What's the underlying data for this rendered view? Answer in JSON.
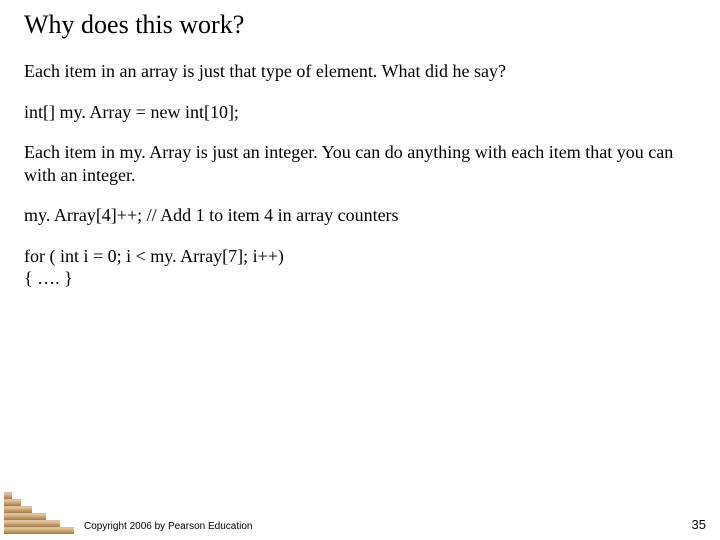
{
  "slide": {
    "title": "Why does this work?",
    "p1": "Each item in an array is just that type of element. What did he say?",
    "p2": "int[]  my. Array = new int[10];",
    "p3": "Each item in my. Array is just an integer.  You can do anything with each item that you can with an integer.",
    "p4": "my. Array[4]++;  // Add 1 to item 4 in array counters",
    "p5": "for ( int i = 0; i < my. Array[7]; i++)",
    "p6": "{ …. }"
  },
  "footer": {
    "copyright": "Copyright 2006 by Pearson Education",
    "page_number": "35"
  }
}
